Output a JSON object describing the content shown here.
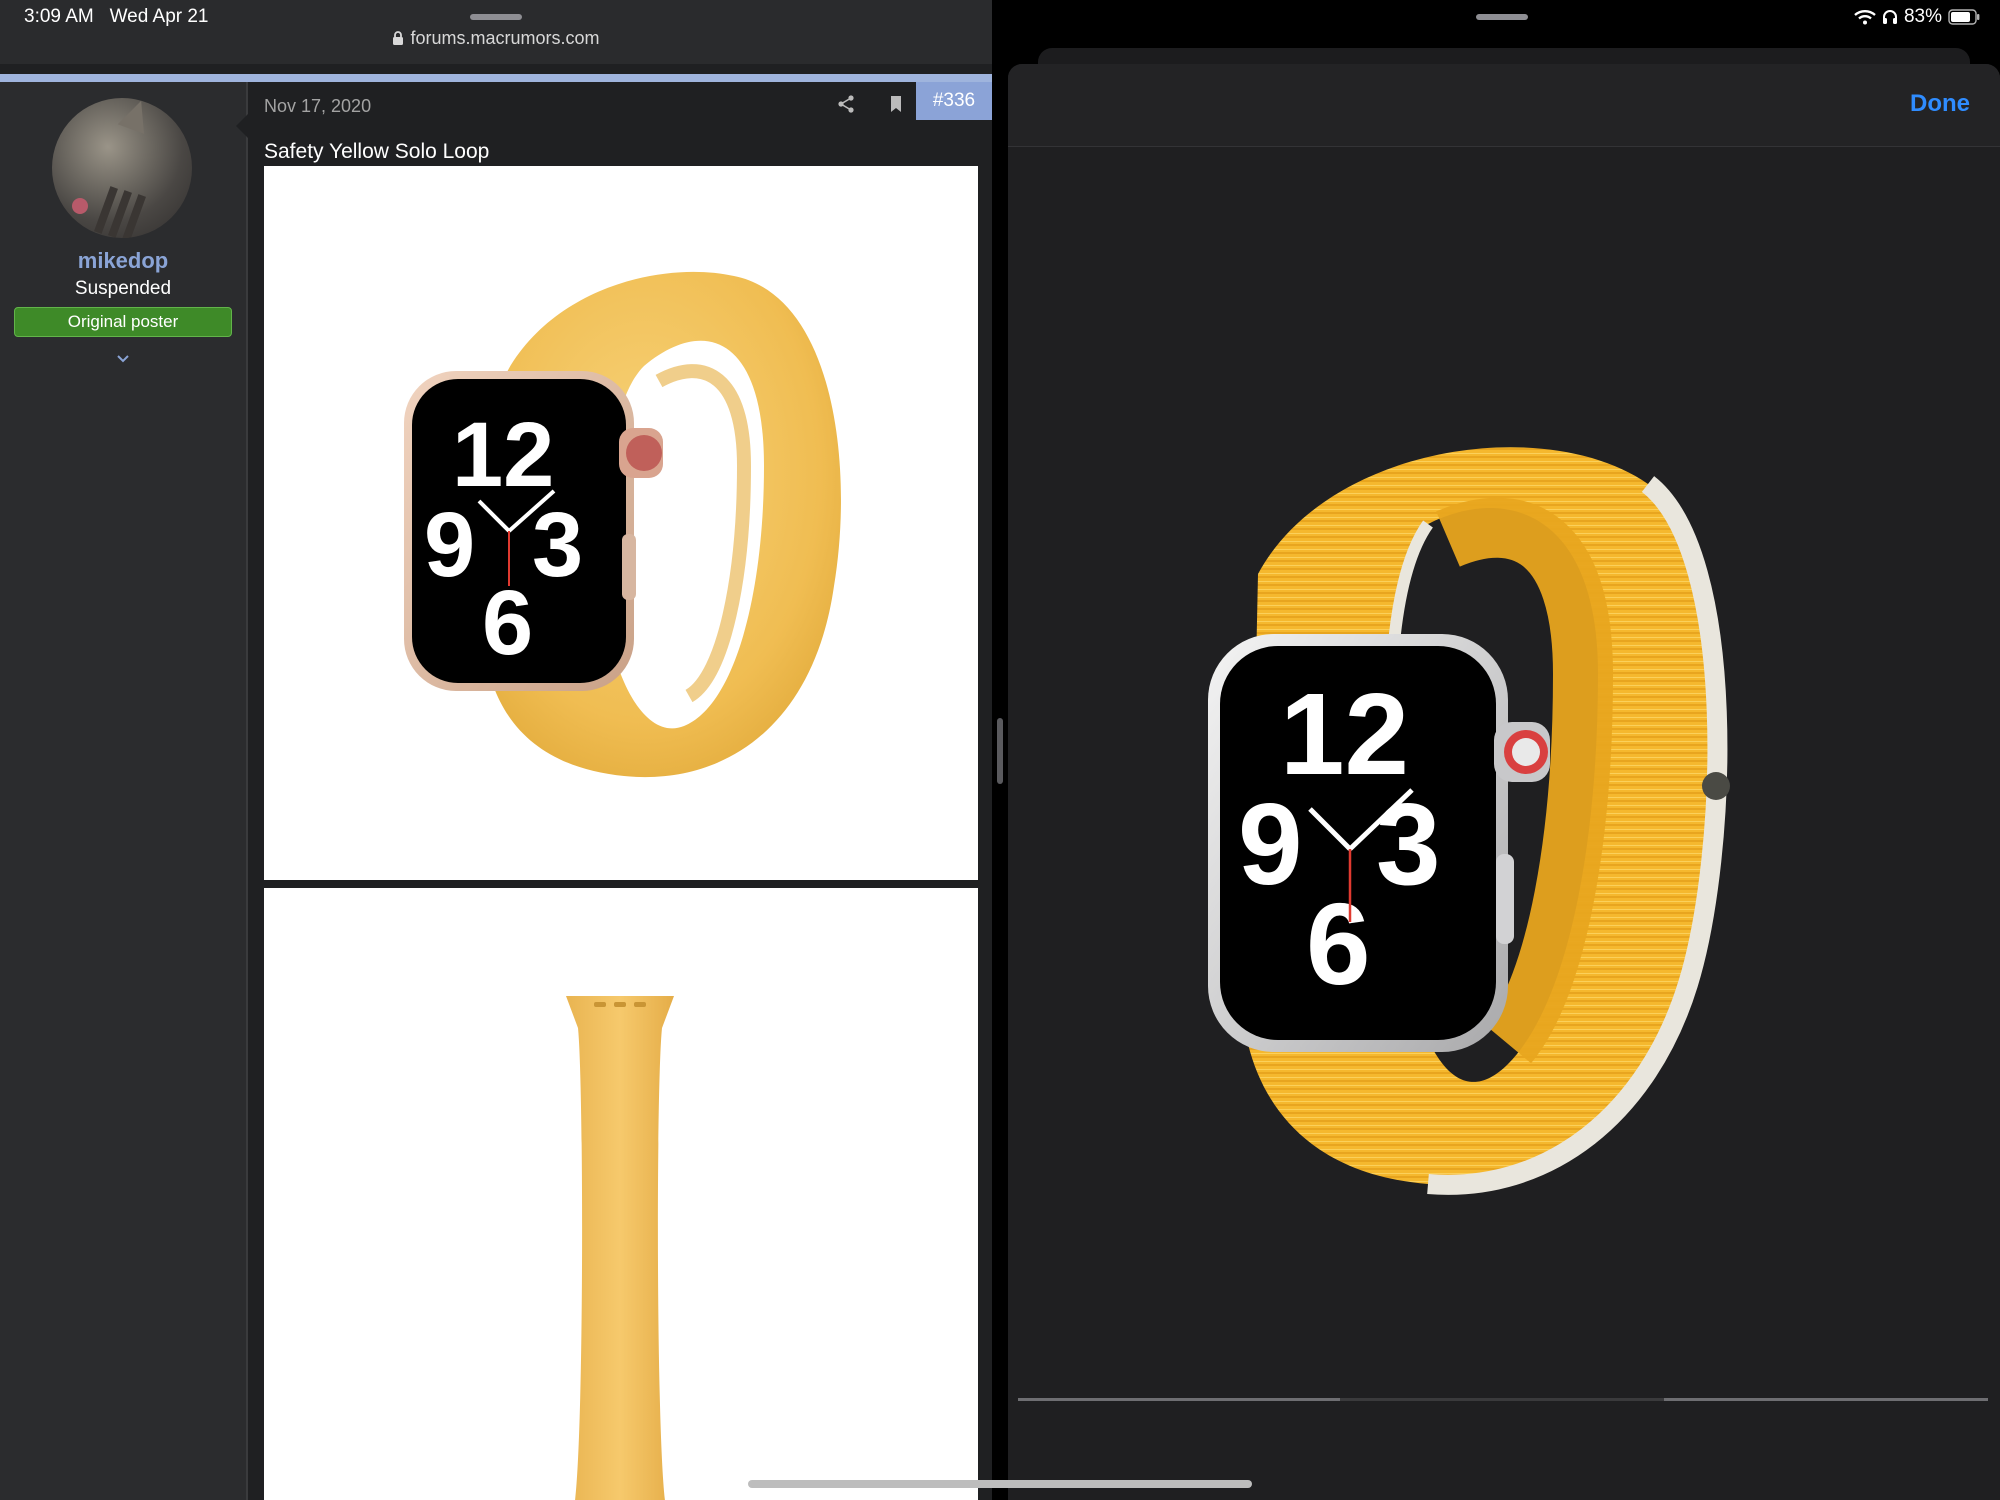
{
  "status_bar": {
    "time": "3:09 AM",
    "date": "Wed Apr 21",
    "battery": "83%"
  },
  "browser": {
    "url": "forums.macrumors.com"
  },
  "user": {
    "name": "mikedop",
    "title": "Suspended",
    "badge": "Original poster"
  },
  "post": {
    "date": "Nov 17, 2020",
    "number": "#336",
    "title": "Safety Yellow Solo Loop"
  },
  "viewer": {
    "done_label": "Done"
  },
  "watch_face": {
    "n12": "12",
    "n9": "9",
    "n3": "3",
    "n6": "6"
  },
  "colors": {
    "accent_blue": "#2f8cff",
    "username_blue": "#8aa4d6",
    "op_green": "#3e8a28",
    "band_yellow": "#f2c35a",
    "loop_yellow": "#f5b82e"
  }
}
